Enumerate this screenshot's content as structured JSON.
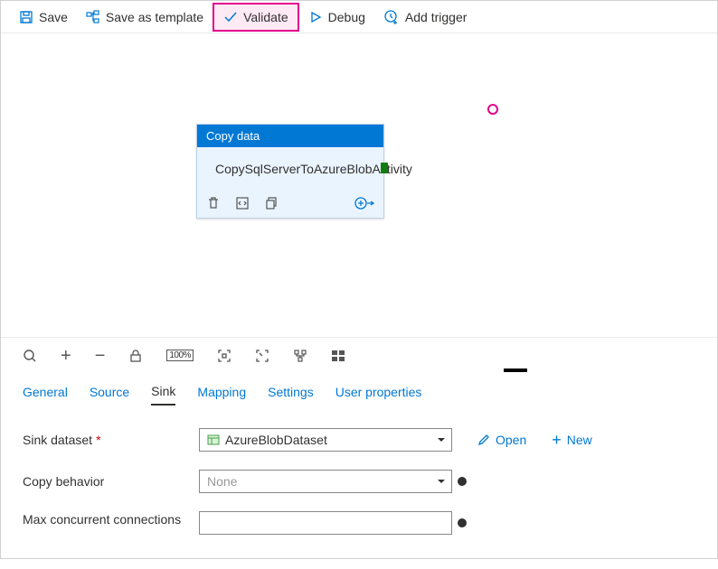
{
  "toolbar": {
    "save": "Save",
    "save_as_template": "Save as template",
    "validate": "Validate",
    "debug": "Debug",
    "add_trigger": "Add trigger"
  },
  "activity": {
    "type_label": "Copy data",
    "name": "CopySqlServerToAzureBlobActivity"
  },
  "tabs": {
    "general": "General",
    "source": "Source",
    "sink": "Sink",
    "mapping": "Mapping",
    "settings": "Settings",
    "user_properties": "User properties"
  },
  "form": {
    "sink_dataset_label": "Sink dataset",
    "sink_dataset_value": "AzureBlobDataset",
    "copy_behavior_label": "Copy behavior",
    "copy_behavior_value": "None",
    "max_conn_label": "Max concurrent connections",
    "max_conn_value": "",
    "open": "Open",
    "new": "New"
  },
  "zoom": "100%"
}
